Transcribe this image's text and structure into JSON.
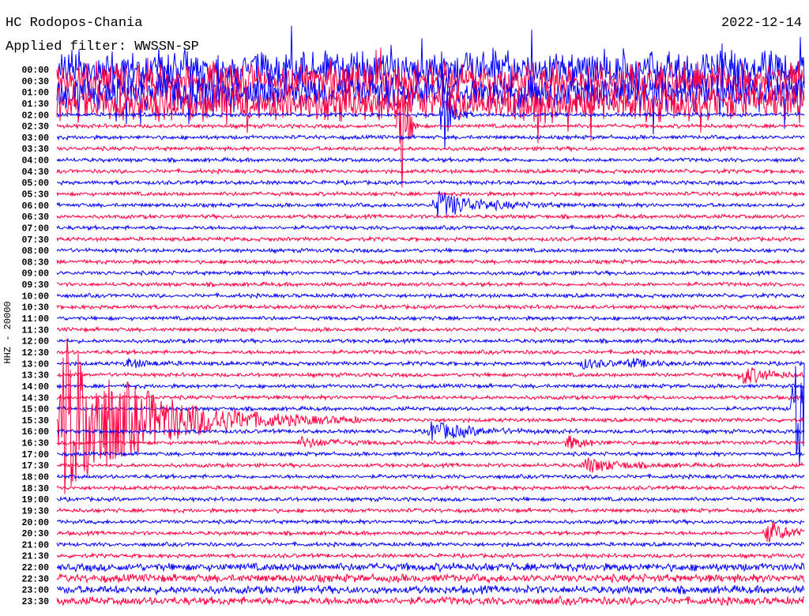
{
  "header": {
    "station": "HC Rodopos-Chania",
    "filter": "Applied filter: WWSSN-SP",
    "date": "2022-12-14"
  },
  "chart_data": {
    "type": "line",
    "title": "HC Rodopos-Chania",
    "ylabel": "HHZ - 20000",
    "row_minutes": 30,
    "row_labels": [
      "00:00",
      "00:30",
      "01:00",
      "01:30",
      "02:00",
      "02:30",
      "03:00",
      "03:30",
      "04:00",
      "04:30",
      "05:00",
      "05:30",
      "06:00",
      "06:30",
      "07:00",
      "07:30",
      "08:00",
      "08:30",
      "09:00",
      "09:30",
      "10:00",
      "10:30",
      "11:00",
      "11:30",
      "12:00",
      "12:30",
      "13:00",
      "13:30",
      "14:00",
      "14:30",
      "15:00",
      "15:30",
      "16:00",
      "16:30",
      "17:00",
      "17:30",
      "18:00",
      "18:30",
      "19:00",
      "19:30",
      "20:00",
      "20:30",
      "21:00",
      "21:30",
      "22:00",
      "22:30",
      "23:00",
      "23:30"
    ],
    "colors": [
      "#0000ff",
      "#ff0040"
    ],
    "noise_levels": {
      "high_rows": [
        0,
        1,
        2,
        3
      ],
      "high": 18,
      "medium_rows": [
        44,
        45,
        46,
        47
      ],
      "medium": 4,
      "base": 2
    },
    "events": [
      {
        "row": 4,
        "minute": 15.5,
        "amp": 60,
        "dur": 0.3
      },
      {
        "row": 5,
        "minute": 13.8,
        "amp": 120,
        "dur": 0.2
      },
      {
        "row": 12,
        "minute": 15.2,
        "amp": 18,
        "dur": 1.5
      },
      {
        "row": 26,
        "minute": 2.8,
        "amp": 6,
        "dur": 0.8
      },
      {
        "row": 26,
        "minute": 21.1,
        "amp": 6,
        "dur": 1.0
      },
      {
        "row": 26,
        "minute": 23.0,
        "amp": 5,
        "dur": 0.8
      },
      {
        "row": 27,
        "minute": 27.5,
        "amp": 12,
        "dur": 1.0
      },
      {
        "row": 31,
        "minute": 0.2,
        "amp": 110,
        "dur": 3.0
      },
      {
        "row": 30,
        "minute": 29.6,
        "amp": 110,
        "dur": 0.6
      },
      {
        "row": 32,
        "minute": 15.0,
        "amp": 12,
        "dur": 1.5
      },
      {
        "row": 33,
        "minute": 9.8,
        "amp": 6,
        "dur": 1.2
      },
      {
        "row": 33,
        "minute": 20.5,
        "amp": 10,
        "dur": 0.6
      },
      {
        "row": 35,
        "minute": 21.2,
        "amp": 10,
        "dur": 1.2
      },
      {
        "row": 41,
        "minute": 28.5,
        "amp": 15,
        "dur": 0.8
      }
    ]
  }
}
